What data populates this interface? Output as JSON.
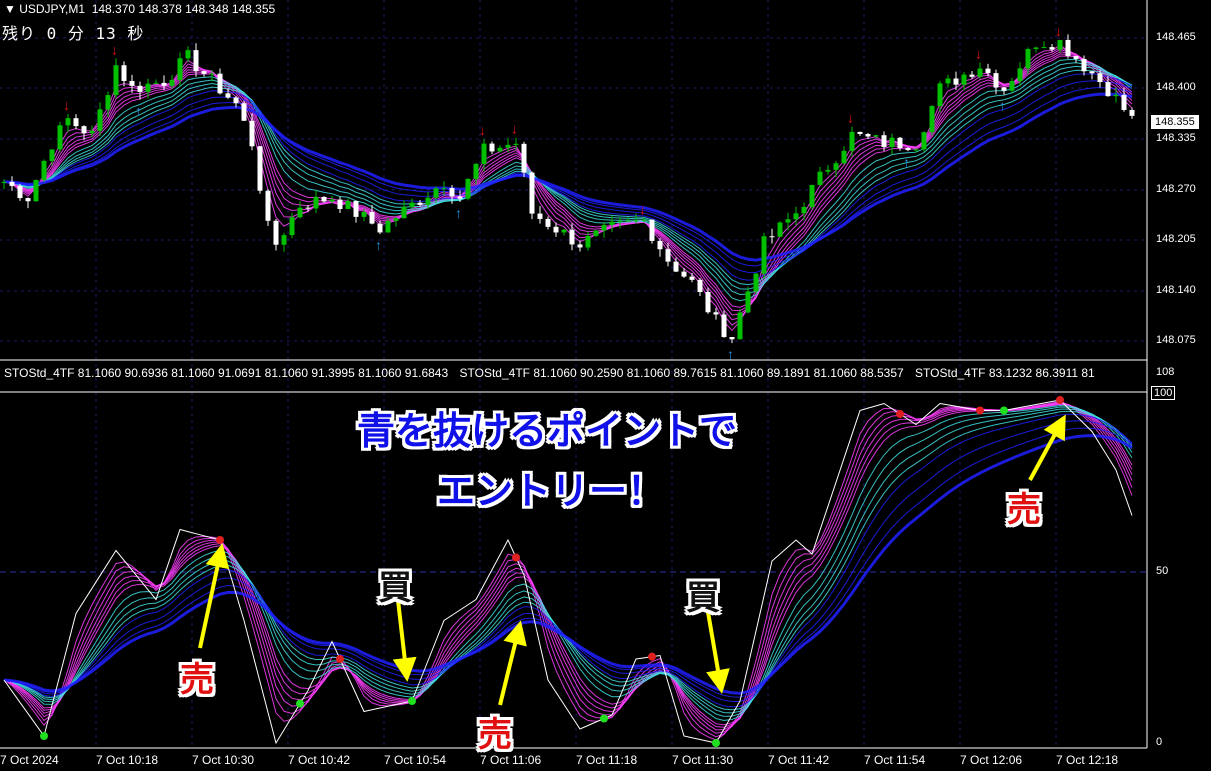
{
  "header": {
    "symbol": "▼ USDJPY,M1",
    "ohlc": "148.370 148.378 148.348 148.355",
    "countdown": "残り 0 分 13 秒"
  },
  "indicator": {
    "labels": [
      "STOStd_4TF 81.1060 90.6936 81.1060 91.0691 81.1060 91.3995 81.1060 91.6843",
      "STOStd_4TF 81.1060 90.2590 81.1060 89.7615 81.1060 89.1891 81.1060 88.5357",
      "STOStd_4TF 83.1232 86.3911 81"
    ]
  },
  "price_axis": [
    "148.465",
    "148.400",
    "148.335",
    "148.270",
    "148.205",
    "148.140",
    "148.075"
  ],
  "current_price": "148.355",
  "osc_axis": {
    "top": "108",
    "max": "100",
    "mid": "50",
    "min": "0"
  },
  "time_axis": [
    "7 Oct 2024",
    "7 Oct 10:18",
    "7 Oct 10:30",
    "7 Oct 10:42",
    "7 Oct 10:54",
    "7 Oct 11:06",
    "7 Oct 11:18",
    "7 Oct 11:30",
    "7 Oct 11:42",
    "7 Oct 11:54",
    "7 Oct 12:06",
    "7 Oct 12:18"
  ],
  "annotation": {
    "line1": "青を抜けるポイントで",
    "line2": "エントリー！"
  },
  "signals": {
    "sell": "売",
    "buy": "買"
  },
  "colors": {
    "bull": "#00c000",
    "bear": "#ffffff",
    "sell_arrow": "#e01010",
    "buy_arrow": "#2090e0",
    "grid": "#1a1a60",
    "ma_slow": "#2020ff",
    "ma_fast": "#ff40ff",
    "ma_mid": "#40e0e0",
    "note": "#ffff00"
  },
  "chart_data": {
    "type": "line",
    "price_path_minutes": [
      0,
      3,
      6,
      8,
      11,
      14,
      16,
      20,
      23,
      26,
      29,
      31,
      33,
      34,
      37,
      41,
      44,
      47,
      51,
      55,
      57,
      60,
      64,
      66,
      69,
      72,
      76,
      80,
      83,
      86,
      89,
      91,
      93,
      95,
      99,
      103,
      106,
      110,
      114,
      117,
      122,
      125,
      129,
      132,
      135,
      138,
      141
    ],
    "price_path": [
      148.28,
      148.26,
      148.33,
      148.36,
      148.34,
      148.43,
      148.4,
      148.41,
      148.44,
      148.41,
      148.38,
      148.33,
      148.22,
      148.2,
      148.25,
      148.26,
      148.24,
      148.22,
      148.25,
      148.28,
      148.26,
      148.32,
      148.33,
      148.24,
      148.22,
      148.2,
      148.22,
      148.23,
      148.18,
      148.15,
      148.1,
      148.08,
      148.14,
      148.2,
      148.24,
      148.3,
      148.34,
      148.33,
      148.33,
      148.4,
      148.43,
      148.4,
      148.46,
      148.46,
      148.43,
      148.4,
      148.36
    ],
    "stoch_minutes": [
      0,
      5,
      9,
      14,
      19,
      22,
      27,
      30,
      34,
      38,
      41,
      45,
      49,
      51,
      55,
      59,
      63,
      65,
      68,
      72,
      76,
      79,
      82,
      85,
      89,
      92,
      96,
      99,
      101,
      107,
      110,
      114,
      117,
      122,
      125,
      132,
      136,
      139,
      141
    ],
    "stoch": [
      18,
      2,
      37,
      55,
      41,
      61,
      58,
      35,
      0,
      15,
      29,
      9,
      11,
      12,
      35,
      41,
      58,
      48,
      18,
      4,
      8,
      24,
      25,
      2,
      0,
      12,
      52,
      58,
      54,
      95,
      97,
      91,
      97,
      95,
      95,
      98,
      89,
      78,
      65
    ],
    "y_range_price": [
      148.075,
      148.465
    ],
    "y_range_osc": [
      0,
      100
    ]
  }
}
